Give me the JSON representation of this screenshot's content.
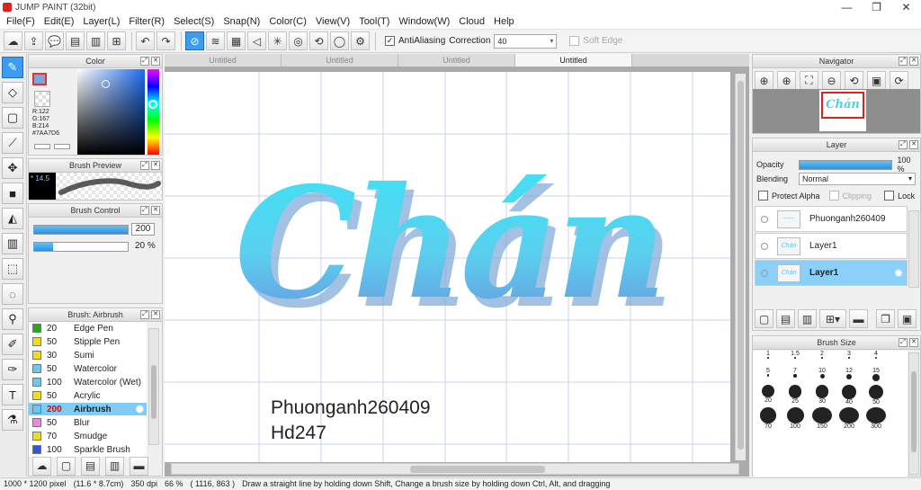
{
  "window": {
    "title": "JUMP PAINT (32bit)",
    "controls": [
      "—",
      "❐",
      "✕"
    ]
  },
  "menu": [
    "File(F)",
    "Edit(E)",
    "Layer(L)",
    "Filter(R)",
    "Select(S)",
    "Snap(N)",
    "Color(C)",
    "View(V)",
    "Tool(T)",
    "Window(W)",
    "Cloud",
    "Help"
  ],
  "toolbar": {
    "icons": [
      "☁",
      "⇪",
      "💬",
      "▤",
      "▥",
      "⊞",
      "▦",
      "↶",
      "↷",
      "⊘",
      "≋",
      "▦",
      "◁",
      "✳",
      "◎",
      "⟲",
      "◯",
      "⚙"
    ],
    "antialiasing_label": "AntiAliasing",
    "antialiasing_checked": "✓",
    "correction_label": "Correction",
    "correction_value": "40",
    "softedge_label": "Soft Edge"
  },
  "tabs": [
    "Untitled",
    "Untitled",
    "Untitled",
    "Untitled"
  ],
  "color_panel": {
    "title": "Color",
    "r": "R:122",
    "g": "G:167",
    "b": "B:214",
    "hex": "#7AA7D6",
    "accent": "#7AA7D6"
  },
  "brush_preview": {
    "title": "Brush Preview",
    "size": "* 14.5"
  },
  "brush_control": {
    "title": "Brush Control",
    "size_value": "200",
    "opacity_value": "20 %"
  },
  "brush_list": {
    "title": "Brush: Airbrush",
    "items": [
      {
        "size": "20",
        "name": "Edge Pen",
        "color": "#22aa22"
      },
      {
        "size": "50",
        "name": "Stipple Pen",
        "color": "#eedd22"
      },
      {
        "size": "30",
        "name": "Sumi",
        "color": "#eedd22"
      },
      {
        "size": "50",
        "name": "Watercolor",
        "color": "#66ccee"
      },
      {
        "size": "100",
        "name": "Watercolor (Wet)",
        "color": "#66ccee"
      },
      {
        "size": "50",
        "name": "Acrylic",
        "color": "#eedd22"
      },
      {
        "size": "200",
        "name": "Airbrush",
        "color": "#66ccee"
      },
      {
        "size": "50",
        "name": "Blur",
        "color": "#ee88dd"
      },
      {
        "size": "70",
        "name": "Smudge",
        "color": "#eedd22"
      },
      {
        "size": "100",
        "name": "Sparkle Brush",
        "color": "#3355dd"
      }
    ]
  },
  "canvas": {
    "lettering": "Chán",
    "signature": "Phuonganh260409",
    "handle": "Hd247"
  },
  "navigator": {
    "title": "Navigator"
  },
  "layer_panel": {
    "title": "Layer",
    "opacity_label": "Opacity",
    "opacity_value": "100 %",
    "opacity_fraction": 1.0,
    "blending_label": "Blending",
    "blending_value": "Normal",
    "protect_alpha": "Protect Alpha",
    "clipping": "Clipping",
    "lock": "Lock",
    "layers": [
      {
        "name": "Phuonganh260409",
        "selected": false
      },
      {
        "name": "Layer1",
        "selected": false
      },
      {
        "name": "Layer1",
        "selected": true
      }
    ]
  },
  "brush_size": {
    "title": "Brush Size",
    "sizes": [
      "1",
      "1.5",
      "2",
      "3",
      "4",
      "5",
      "7",
      "10",
      "12",
      "15",
      "20",
      "25",
      "30",
      "40",
      "50",
      "70",
      "100",
      "150",
      "200",
      "300"
    ]
  },
  "status": {
    "pixels": "1000 * 1200 pixel",
    "physical": "(11.6 * 8.7cm)",
    "dpi": "350 dpi",
    "zoom": "66 %",
    "coords": "( 1116, 863 )",
    "hint": "Draw a straight line by holding down Shift, Change a brush size by holding down Ctrl, Alt, and dragging"
  }
}
